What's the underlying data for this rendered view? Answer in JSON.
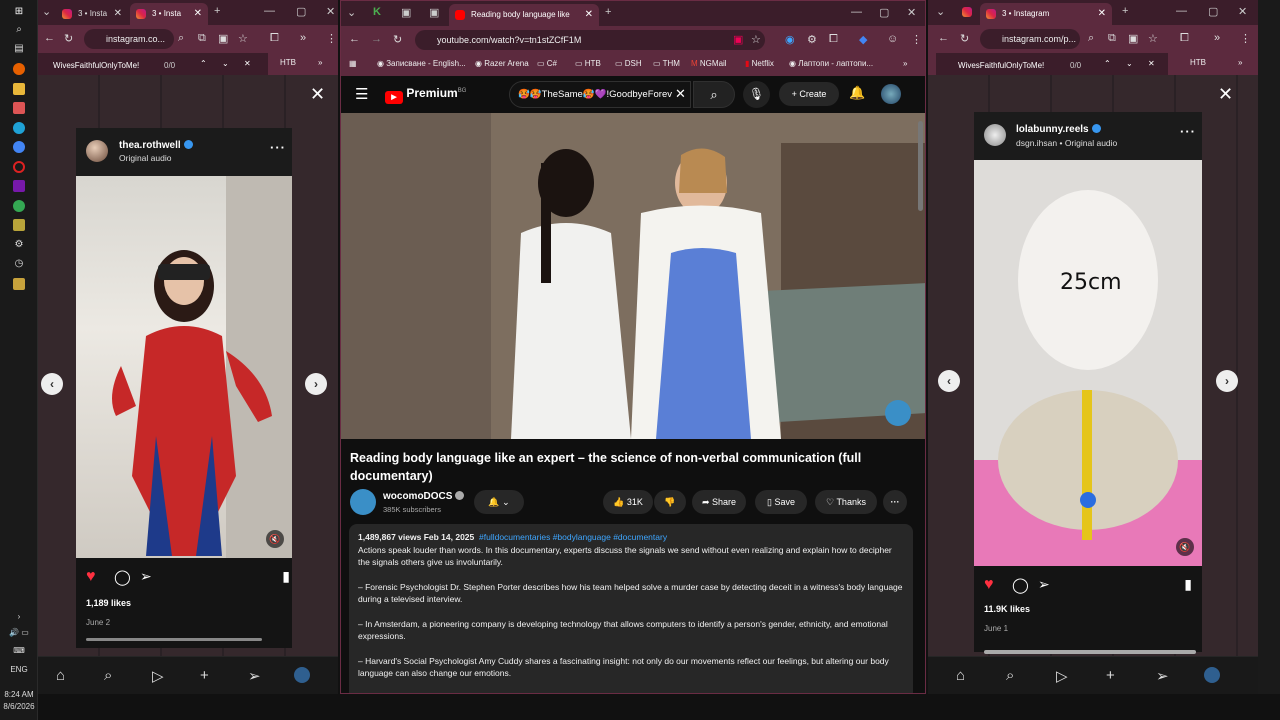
{
  "taskbar": {
    "time": "8:24 AM",
    "date": "8/6/2026",
    "lang": "ENG"
  },
  "left_window": {
    "tab1": "3 • Insta",
    "tab2": "3 • Insta",
    "url": "instagram.co...",
    "find_text": "WivesFaithfulOnlyToMe!",
    "find_count": "0/0",
    "bookmark": "HTB",
    "post": {
      "username": "thea.rothwell",
      "subtitle": "Original audio",
      "likes": "1,189 likes",
      "date": "June 2"
    }
  },
  "middle_window": {
    "tab": "Reading body language like",
    "url": "youtube.com/watch?v=tn1stZCfF1M",
    "bookmarks": [
      "Записване - English...",
      "Razer Arena",
      "C#",
      "HTB",
      "DSH",
      "THM",
      "NGMail",
      "Netflix",
      "Лаптопи - лаптопи..."
    ],
    "logo": "Premium",
    "logo_sup": "BG",
    "search_value": "🥵🥵TheSame🥵💜!GoodbyeForev",
    "create": "Create",
    "video_title": "Reading body language like an expert – the science of non-verbal communication (full documentary)",
    "channel": "wocomoDOCS",
    "subscribers": "385K subscribers",
    "likes": "31K",
    "share": "Share",
    "save": "Save",
    "thanks": "Thanks",
    "meta": "1,489,867 views  Feb 14, 2025",
    "tags": "#fulldocumentaries #bodylanguage #documentary",
    "desc_1": "Actions speak louder than words. In this documentary, experts discuss the signals we send without even realizing and explain how to decipher the signals others give us involuntarily.",
    "desc_2": "– Forensic Psychologist Dr. Stephen Porter describes how his team helped solve a murder case by detecting deceit in a witness's body language during a televised interview.",
    "desc_3": "– In Amsterdam, a pioneering company is developing technology that allows computers to identify a person's gender, ethnicity, and emotional expressions.",
    "desc_4": "– Harvard's Social Psychologist Amy Cuddy shares a fascinating insight: not only do our movements reflect our feelings, but altering our body language can also change our emotions."
  },
  "right_window": {
    "tab": "3 • Instagram",
    "url": "instagram.com/p...",
    "find_text": "WivesFaithfulOnlyToMe!",
    "find_count": "0/0",
    "bookmark": "HTB",
    "post": {
      "username": "lolabunny.reels",
      "subtitle": "dsgn.ihsan • Original audio",
      "overlay": "25cm",
      "likes": "11.9K likes",
      "date": "June 1"
    }
  }
}
